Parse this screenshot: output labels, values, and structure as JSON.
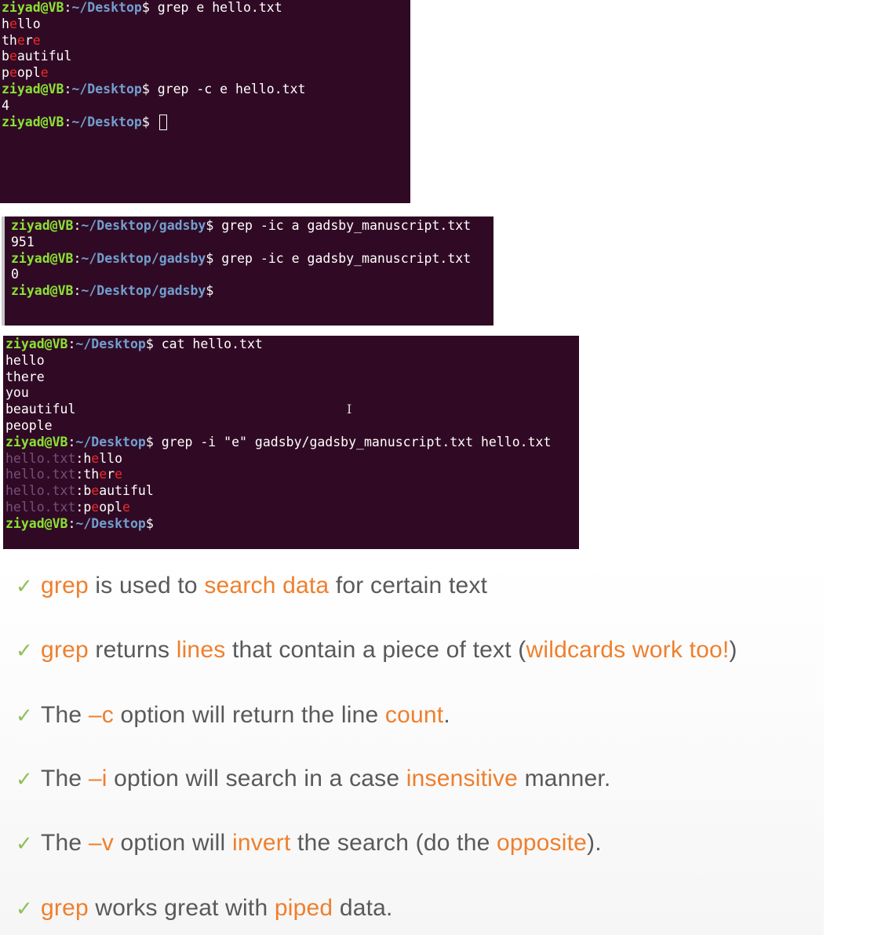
{
  "terminal1": {
    "lines": {
      "p1_user": "ziyad@VB",
      "p1_colon": ":",
      "p1_path": "~/Desktop",
      "p1_cmd": "$ grep e hello.txt",
      "o1_a": "h",
      "o1_b": "e",
      "o1_c": "llo",
      "o2_a": "th",
      "o2_b": "e",
      "o2_c": "r",
      "o2_d": "e",
      "o3_a": "b",
      "o3_b": "e",
      "o3_c": "autiful",
      "o4_a": "p",
      "o4_b": "e",
      "o4_c": "opl",
      "o4_d": "e",
      "p2_user": "ziyad@VB",
      "p2_colon": ":",
      "p2_path": "~/Desktop",
      "p2_cmd": "$ grep -c e hello.txt",
      "o5": "4",
      "p3_user": "ziyad@VB",
      "p3_colon": ":",
      "p3_path": "~/Desktop",
      "p3_cmd": "$ "
    }
  },
  "terminal2": {
    "lines": {
      "p1_user": "ziyad@VB",
      "p1_colon": ":",
      "p1_path": "~/Desktop/gadsby",
      "p1_cmd": "$ grep -ic a gadsby_manuscript.txt",
      "o1": "951",
      "p2_user": "ziyad@VB",
      "p2_colon": ":",
      "p2_path": "~/Desktop/gadsby",
      "p2_cmd": "$ grep -ic e gadsby_manuscript.txt",
      "o2": "0",
      "p3_user": "ziyad@VB",
      "p3_colon": ":",
      "p3_path": "~/Desktop/gadsby",
      "p3_cmd": "$"
    }
  },
  "terminal3": {
    "lines": {
      "p1_user": "ziyad@VB",
      "p1_colon": ":",
      "p1_path": "~/Desktop",
      "p1_cmd": "$ cat hello.txt",
      "c1": "hello",
      "c2": "there",
      "c3": "you",
      "c4": "beautiful",
      "c5": "people",
      "p2_user": "ziyad@VB",
      "p2_colon": ":",
      "p2_path": "~/Desktop",
      "p2_cmd": "$ grep -i \"e\" gadsby/gadsby_manuscript.txt hello.txt",
      "fname": "hello.txt",
      "sep": ":",
      "r1_a": "h",
      "r1_b": "e",
      "r1_c": "llo",
      "r2_a": "th",
      "r2_b": "e",
      "r2_c": "r",
      "r2_d": "e",
      "r3_a": "b",
      "r3_b": "e",
      "r3_c": "autiful",
      "r4_a": "p",
      "r4_b": "e",
      "r4_c": "opl",
      "r4_d": "e",
      "p3_user": "ziyad@VB",
      "p3_colon": ":",
      "p3_path": "~/Desktop",
      "p3_cmd": "$",
      "ibeam": "I"
    }
  },
  "slide": {
    "check": "✓",
    "b1": {
      "a": "grep",
      "b": " is used to ",
      "c": "search data",
      "d": " for certain text"
    },
    "b2": {
      "a": "grep",
      "b": " returns ",
      "c": "lines",
      "d": " that contain a piece of text (",
      "e": "wildcards work too!",
      "f": ")"
    },
    "b3": {
      "a": "The ",
      "b": "–c",
      "c": " option will return the line ",
      "d": "count",
      "e": "."
    },
    "b4": {
      "a": "The ",
      "b": "–i",
      "c": " option will search in a case ",
      "d": "insensitive",
      "e": " manner."
    },
    "b5": {
      "a": "The ",
      "b": "–v",
      "c": " option will ",
      "d": "invert",
      "e": " the search (do the ",
      "f": "opposite",
      "g": ")."
    },
    "b6": {
      "a": "grep",
      "b": " works great with ",
      "c": "piped",
      "d": " data."
    }
  },
  "colors": {
    "terminal_bg": "#300a24",
    "prompt_user": "#8ae234",
    "prompt_path": "#729fcf",
    "match": "#ef2929",
    "filename": "#75507b",
    "slide_accent": "#ef7f2d",
    "slide_text": "#595959",
    "check": "#8fbf5a"
  }
}
